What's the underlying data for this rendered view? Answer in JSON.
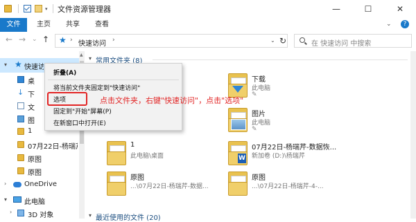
{
  "window": {
    "title": "文件资源管理器",
    "min_glyph": "—",
    "max_glyph": "☐",
    "close_glyph": "✕"
  },
  "quick_access_toolbar": {
    "dropdown_glyph": "▾"
  },
  "ribbon": {
    "tabs": [
      "文件",
      "主页",
      "共享",
      "查看"
    ],
    "collapse_glyph": "⌄",
    "help_glyph": "?"
  },
  "nav": {
    "back_glyph": "←",
    "forward_glyph": "→",
    "recent_glyph": "⌄",
    "up_glyph": "↑"
  },
  "address": {
    "path": "快速访问",
    "chevron": "›",
    "dropdown_glyph": "⌄",
    "refresh_glyph": "↻"
  },
  "search": {
    "placeholder": "在 快速访问 中搜索"
  },
  "sidebar": {
    "quick_access_label": "快速访问",
    "items": [
      {
        "label": "桌",
        "icon": "desktop-icon"
      },
      {
        "label": "下",
        "icon": "download-icon"
      },
      {
        "label": "文",
        "icon": "document-icon"
      },
      {
        "label": "图",
        "icon": "picture-icon"
      },
      {
        "label": "1",
        "icon": "folder-icon"
      },
      {
        "label": "07月22日-杨瑞芹",
        "icon": "folder-icon"
      },
      {
        "label": "原图",
        "icon": "folder-icon"
      },
      {
        "label": "原图",
        "icon": "folder-icon"
      }
    ],
    "onedrive": "OneDrive",
    "this_pc": "此电脑",
    "objects_3d": "3D 对象"
  },
  "content": {
    "frequent_header": "常用文件夹 (8)",
    "recent_header": "最近使用的文件 (20)",
    "items": [
      {
        "name": "下载",
        "location": "此电脑",
        "pin": "✎"
      },
      {
        "name": "图片",
        "location": "此电脑",
        "pin": "✎"
      },
      {
        "name": "1",
        "location": "此电脑\\桌面"
      },
      {
        "name": "07月22日-杨瑞芹-数据恢...",
        "location": "新加卷 (D:)\\杨瑞芹"
      },
      {
        "name": "原图",
        "location": "...\\07月22日-杨瑞芹-数据..."
      },
      {
        "name": "原图",
        "location": "...\\07月22日-杨瑞芹-4-..."
      }
    ]
  },
  "context_menu": {
    "items": [
      "折叠(A)",
      "将当前文件夹固定到\"快速访问\"",
      "选项",
      "固定到\"开始\"屏幕(P)",
      "在新窗口中打开(E)"
    ]
  },
  "annotation": {
    "text": "点击文件夹，右键\"快速访问\"，点击\"选项\""
  }
}
